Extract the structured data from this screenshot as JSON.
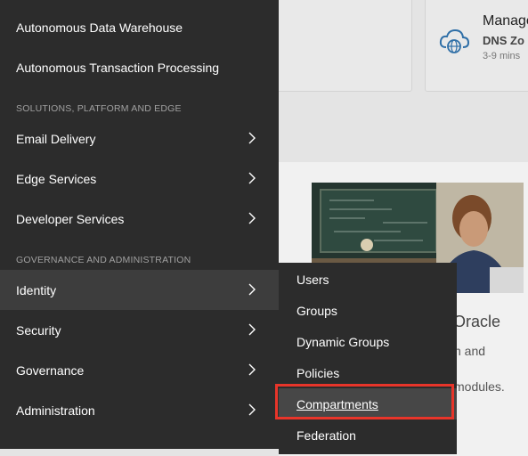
{
  "background": {
    "card_right": {
      "title": "Manage",
      "subtitle": "DNS Zo",
      "duration": "3-9 mins",
      "icon": "cloud-globe-icon"
    },
    "promo": {
      "title": "Oracle",
      "desc_line1": "n and",
      "desc_line2": "modules."
    }
  },
  "nav": {
    "items_top": [
      {
        "label": "Autonomous Data Warehouse"
      },
      {
        "label": "Autonomous Transaction Processing"
      }
    ],
    "section_solutions": "SOLUTIONS, PLATFORM AND EDGE",
    "items_solutions": [
      {
        "label": "Email Delivery"
      },
      {
        "label": "Edge Services"
      },
      {
        "label": "Developer Services"
      }
    ],
    "section_governance": "GOVERNANCE AND ADMINISTRATION",
    "items_governance": [
      {
        "label": "Identity"
      },
      {
        "label": "Security"
      },
      {
        "label": "Governance"
      },
      {
        "label": "Administration"
      }
    ]
  },
  "submenu": {
    "items": [
      {
        "label": "Users"
      },
      {
        "label": "Groups"
      },
      {
        "label": "Dynamic Groups"
      },
      {
        "label": "Policies"
      },
      {
        "label": "Compartments"
      },
      {
        "label": "Federation"
      }
    ]
  },
  "colors": {
    "menu_bg": "#2c2c2c",
    "active_bg": "#3d3d3d",
    "highlight_border": "#e8352a"
  }
}
